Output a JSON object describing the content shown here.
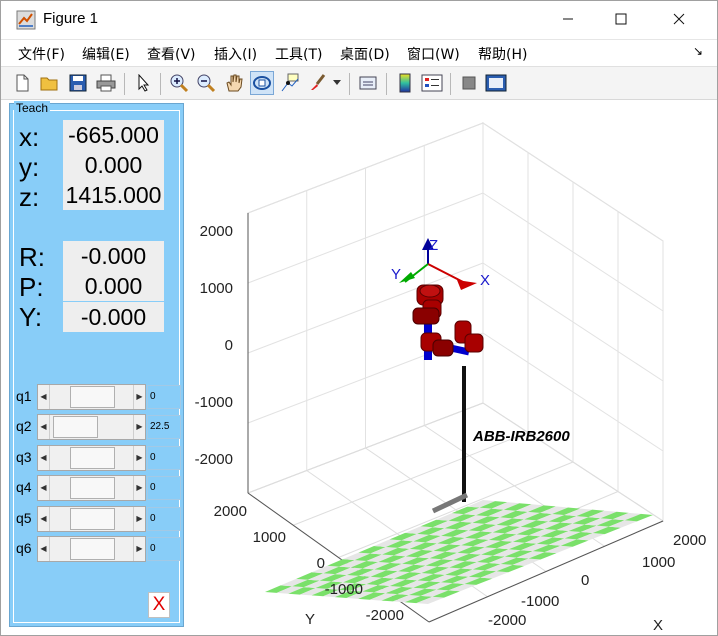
{
  "window": {
    "title": "Figure 1"
  },
  "menu": [
    "文件(F)",
    "编辑(E)",
    "查看(V)",
    "插入(I)",
    "工具(T)",
    "桌面(D)",
    "窗口(W)",
    "帮助(H)"
  ],
  "toolbar": [
    "new-figure-icon",
    "open-file-icon",
    "save-icon",
    "print-icon",
    "pointer-icon",
    "zoom-in-icon",
    "zoom-out-icon",
    "pan-icon",
    "rotate-3d-icon",
    "data-cursor-icon",
    "brush-icon",
    "link-plot-icon",
    "colorbar-icon",
    "legend-icon",
    "hide-plot-tools-icon",
    "show-plot-tools-icon"
  ],
  "teach": {
    "title": "Teach",
    "position": [
      {
        "label": "x:",
        "value": "-665.000"
      },
      {
        "label": "y:",
        "value": "0.000"
      },
      {
        "label": "z:",
        "value": "1415.000"
      }
    ],
    "orientation": [
      {
        "label": "R:",
        "value": "-0.000"
      },
      {
        "label": "P:",
        "value": "0.000"
      },
      {
        "label": "Y:",
        "value": "-0.000"
      }
    ],
    "joints": [
      {
        "label": "q1",
        "value": "0",
        "level": 0.5
      },
      {
        "label": "q2",
        "value": "22.5",
        "level": 0.08
      },
      {
        "label": "q3",
        "value": "0",
        "level": 0.5
      },
      {
        "label": "q4",
        "value": "0",
        "level": 0.5
      },
      {
        "label": "q5",
        "value": "0",
        "level": 0.5
      },
      {
        "label": "q6",
        "value": "0",
        "level": 0.5
      }
    ],
    "close_label": "X"
  },
  "plot": {
    "robot_name": "ABB-IRB2600",
    "z_ticks": [
      "2000",
      "1000",
      "0",
      "-1000",
      "-2000"
    ],
    "y_ticks": [
      "2000",
      "1000",
      "0",
      "-1000",
      "-2000"
    ],
    "x_ticks": [
      "2000",
      "1000",
      "0",
      "-1000",
      "-2000"
    ],
    "y_label": "Y",
    "x_label": "X",
    "frame_labels": {
      "x": "X",
      "y": "Y",
      "z": "Z"
    },
    "colors": {
      "floor_green": "#7ae06a",
      "floor_grey": "#e6e6e6",
      "link_red": "#a80000",
      "link_blue": "#0000cc",
      "panel_blue": "#88cdf8"
    }
  }
}
